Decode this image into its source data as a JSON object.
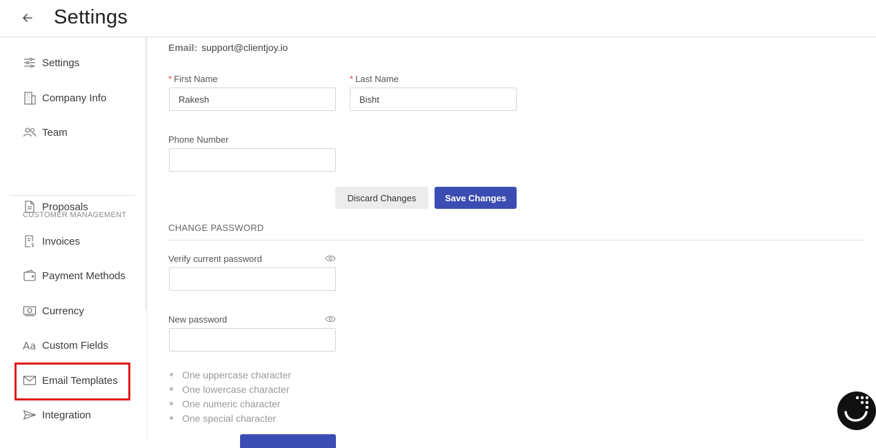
{
  "header": {
    "title": "Settings"
  },
  "sidebar": {
    "items": [
      {
        "label": "Settings",
        "icon": "sliders-icon"
      },
      {
        "label": "Company Info",
        "icon": "building-icon"
      },
      {
        "label": "Team",
        "icon": "team-icon"
      }
    ],
    "section_title": "CUSTOMER MANAGEMENT",
    "section_items": [
      {
        "label": "Proposals",
        "icon": "document-icon"
      },
      {
        "label": "Invoices",
        "icon": "invoice-icon"
      },
      {
        "label": "Payment Methods",
        "icon": "wallet-icon"
      },
      {
        "label": "Currency",
        "icon": "banknote-icon"
      },
      {
        "label": "Custom Fields",
        "icon": "text-format-icon"
      },
      {
        "label": "Email Templates",
        "icon": "envelope-icon"
      },
      {
        "label": "Integration",
        "icon": "paper-plane-icon"
      }
    ],
    "highlighted": "Email Templates",
    "highlight_color": "#e01919"
  },
  "profile": {
    "email_label": "Email:",
    "email_value": "support@clientjoy.io",
    "first_name_label": "First Name",
    "first_name_value": "Rakesh",
    "last_name_label": "Last Name",
    "last_name_value": "Bisht",
    "phone_label": "Phone Number",
    "phone_value": "",
    "required_mark": "*",
    "discard_label": "Discard Changes",
    "save_label": "Save Changes"
  },
  "password": {
    "section_title": "CHANGE PASSWORD",
    "current_label": "Verify current password",
    "new_label": "New password",
    "rules": [
      "One uppercase character",
      "One lowercase character",
      "One numeric character",
      "One special character"
    ]
  },
  "colors": {
    "primary": "#3b4db3",
    "required": "#e04545"
  }
}
